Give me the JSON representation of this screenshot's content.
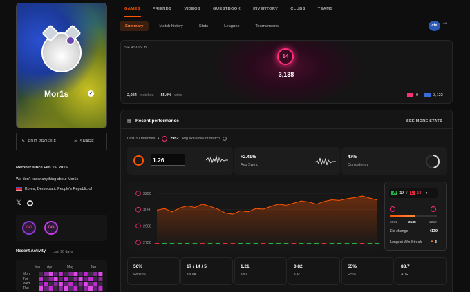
{
  "profile": {
    "name": "Mor1s",
    "edit_label": "EDIT PROFILE",
    "share_label": "SHARE",
    "member_since": "Member since Feb 15, 2015",
    "bio": "We don't know anything about Mor1s",
    "country": "Korea, Democratic People's Republic of",
    "badges": [
      "GG",
      "GG"
    ],
    "recent_activity_title": "Recent Activity",
    "recent_activity_period": "Last 90 days",
    "months": [
      "Mar",
      "Apr",
      "May",
      "Jun"
    ],
    "days": [
      "Mon",
      "Tue",
      "Wed",
      "Thu"
    ]
  },
  "nav": {
    "tabs": [
      "GAMES",
      "FRIENDS",
      "VIDEOS",
      "GUESTBOOK",
      "INVENTORY",
      "CLUBS",
      "TEAMS"
    ],
    "subtabs": [
      "Summary",
      "Match history",
      "Stats",
      "Leagues",
      "Tournaments"
    ],
    "team_logo": "cfs",
    "more": "•••"
  },
  "season": {
    "label": "SEASON 8",
    "level": "14",
    "elo": "3,138",
    "matches": "2,024",
    "matches_label": "matches",
    "win_pct": "55.0%",
    "wins_label": "wins",
    "stat_a": "9",
    "stat_b": "3,122"
  },
  "performance": {
    "title": "Recent performance",
    "see_more": "SEE MORE STATS",
    "last_matches": "Last 30 Matches",
    "avg_skill": "2952",
    "avg_skill_label": "Avg skill level of Match",
    "tile1_value": "1.26",
    "tile2_value": "+2.41%",
    "tile2_label": "Avg Swing",
    "tile3_value": "47%",
    "tile3_label": "Consistency"
  },
  "chart_data": {
    "type": "line",
    "yticks": [
      3200,
      3050,
      2900,
      2750
    ],
    "ylim": [
      2700,
      3270
    ],
    "values": [
      3045,
      3060,
      3030,
      3065,
      3085,
      3070,
      3100,
      3080,
      3055,
      3020,
      3010,
      3040,
      3030,
      3060,
      3055,
      3080,
      3100,
      3090,
      3110,
      3130,
      3120,
      3100,
      3125,
      3140,
      3135,
      3150,
      3160,
      3175,
      3155,
      3138
    ],
    "results": [
      "L",
      "W",
      "W",
      "W",
      "W",
      "W",
      "L",
      "W",
      "W",
      "L",
      "L",
      "W",
      "W",
      "W",
      "L",
      "W",
      "W",
      "W",
      "L",
      "W",
      "W",
      "W",
      "L",
      "W",
      "W",
      "W",
      "W",
      "L",
      "W",
      "W"
    ]
  },
  "elo_card": {
    "wins": "17",
    "losses": "13",
    "bar_min": "3001",
    "bar_current": "3138",
    "bar_max": "3250",
    "elo_change_label": "Elo change",
    "elo_change": "+130",
    "streak_label": "Longest Win Streak",
    "streak": "3"
  },
  "stats": [
    {
      "value": "56%",
      "label": "Wins %"
    },
    {
      "value": "17 / 14 / 5",
      "label": "K/D/A"
    },
    {
      "value": "1.21",
      "label": "K/D"
    },
    {
      "value": "0.82",
      "label": "K/R"
    },
    {
      "value": "55%",
      "label": "HS%"
    },
    {
      "value": "88.7",
      "label": "ADR"
    }
  ],
  "colors": {
    "accent": "#ff5500",
    "level": "#ff2d7a",
    "win": "#22b34a",
    "loss": "#e02d3c"
  }
}
